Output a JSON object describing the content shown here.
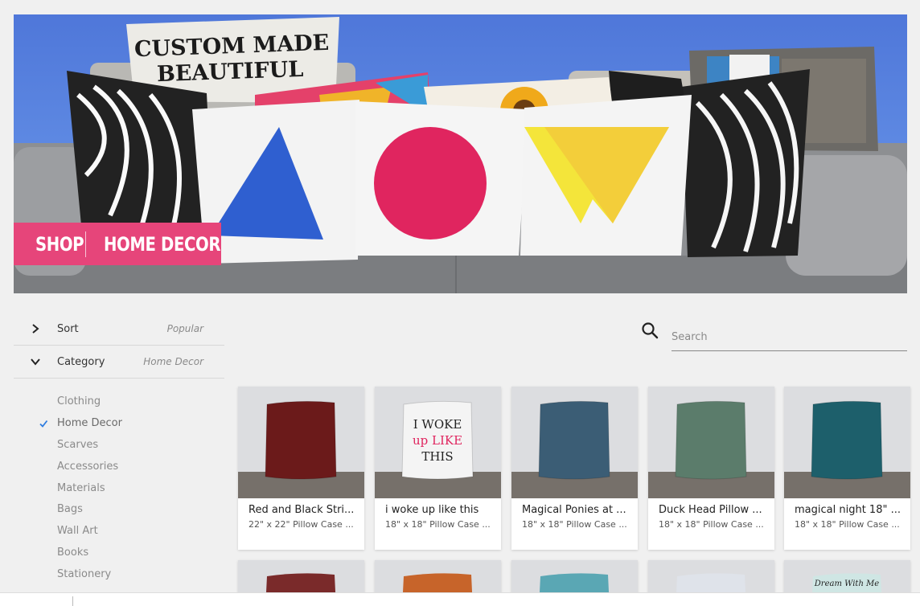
{
  "hero": {
    "shop_label": "SHOP",
    "section_label": "HOME DECOR",
    "pillow_line1": "CUSTOM MADE",
    "pillow_line2": "BEAUTIFUL"
  },
  "sidebar": {
    "sort": {
      "label": "Sort",
      "value": "Popular"
    },
    "category": {
      "label": "Category",
      "value": "Home Decor"
    },
    "categories": [
      {
        "label": "Clothing",
        "selected": false
      },
      {
        "label": "Home Decor",
        "selected": true
      },
      {
        "label": "Scarves",
        "selected": false
      },
      {
        "label": "Accessories",
        "selected": false
      },
      {
        "label": "Materials",
        "selected": false
      },
      {
        "label": "Bags",
        "selected": false
      },
      {
        "label": "Wall Art",
        "selected": false
      },
      {
        "label": "Books",
        "selected": false
      },
      {
        "label": "Stationery",
        "selected": false
      }
    ]
  },
  "search": {
    "placeholder": "Search"
  },
  "products": [
    {
      "title": "Red and Black Stri...",
      "subtitle": "22\" x 22\" Pillow Case ...",
      "pillow_color": "#6b1a1a",
      "pillow_text": ""
    },
    {
      "title": "i woke up like this",
      "subtitle": "18\" x 18\" Pillow Case ...",
      "pillow_color": "#f4f4f4",
      "pillow_text": "I WOKE up LIKE THIS"
    },
    {
      "title": "Magical Ponies at ...",
      "subtitle": "18\" x 18\" Pillow Case ...",
      "pillow_color": "#3b5d75",
      "pillow_text": ""
    },
    {
      "title": "Duck Head Pillow ...",
      "subtitle": "18\" x 18\" Pillow Case ...",
      "pillow_color": "#5b7c6b",
      "pillow_text": ""
    },
    {
      "title": "magical night 18\" ...",
      "subtitle": "18\" x 18\" Pillow Case ...",
      "pillow_color": "#1d5f6b",
      "pillow_text": ""
    }
  ],
  "products_row2": [
    {
      "pillow_color": "#7a2a2a",
      "pillow_text": ""
    },
    {
      "pillow_color": "#c7642a",
      "pillow_text": ""
    },
    {
      "pillow_color": "#5aa7b4",
      "pillow_text": ""
    },
    {
      "pillow_color": "#dfe3ea",
      "pillow_text": ""
    },
    {
      "pillow_color": "#cfe6e4",
      "pillow_text": "Dream With Me"
    }
  ]
}
